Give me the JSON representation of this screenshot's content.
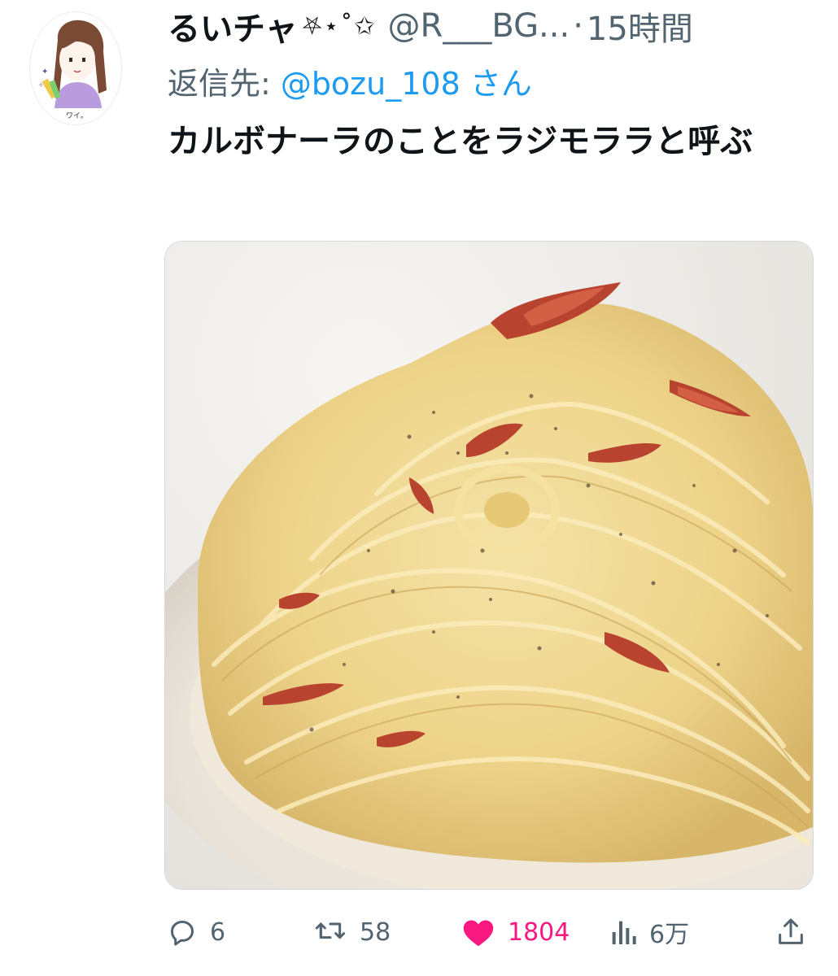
{
  "tweet": {
    "display_name": "るいチャ",
    "name_decoration": "⛧⋆˚✩",
    "handle": "@R___BG...",
    "separator": "·",
    "time": "15時間",
    "reply_label": "返信先:",
    "reply_handle": "@bozu_108 さん",
    "text": "カルボナーラのことをラジモララと呼ぶ",
    "avatar_caption": "ワイ。"
  },
  "actions": {
    "reply_count": "6",
    "retweet_count": "58",
    "like_count": "1804",
    "views_count": "6万"
  },
  "icons": {
    "reply": "reply-icon",
    "retweet": "retweet-icon",
    "like": "heart-icon",
    "views": "views-icon",
    "share": "share-icon"
  },
  "colors": {
    "text": "#0f1419",
    "secondary": "#536471",
    "link": "#1d9bf0",
    "like": "#f91880"
  },
  "like_active": true
}
